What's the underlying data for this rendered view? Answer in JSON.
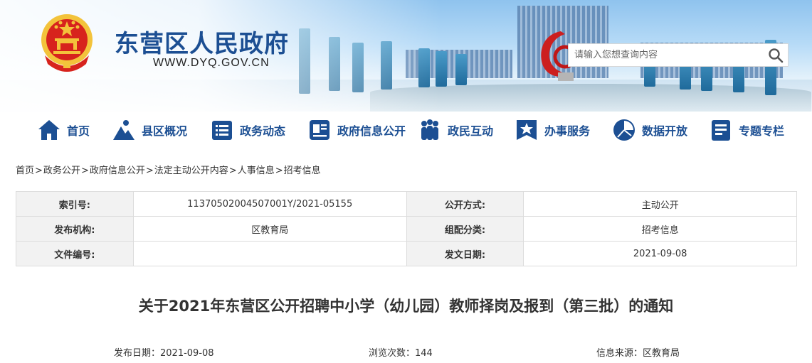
{
  "site": {
    "name": "东营区人民政府",
    "url": "WWW.DYQ.GOV.CN"
  },
  "search": {
    "placeholder": "请输入您想查询内容"
  },
  "nav": {
    "items": [
      {
        "label": "首页",
        "icon": "home-icon"
      },
      {
        "label": "县区概况",
        "icon": "mountain-icon"
      },
      {
        "label": "政务动态",
        "icon": "news-icon"
      },
      {
        "label": "政府信息公开",
        "icon": "document-icon"
      },
      {
        "label": "政民互动",
        "icon": "people-icon"
      },
      {
        "label": "办事服务",
        "icon": "star-icon"
      },
      {
        "label": "数据开放",
        "icon": "pie-chart-icon"
      },
      {
        "label": "专题专栏",
        "icon": "clipboard-icon"
      }
    ]
  },
  "breadcrumb": [
    "首页",
    "政务公开",
    "政府信息公开",
    "法定主动公开内容",
    "人事信息",
    "招考信息"
  ],
  "info": {
    "rows": [
      {
        "k1": "索引号:",
        "v1": "11370502004507001Y/2021-05155",
        "k2": "公开方式:",
        "v2": "主动公开"
      },
      {
        "k1": "发布机构:",
        "v1": "区教育局",
        "k2": "组配分类:",
        "v2": "招考信息"
      },
      {
        "k1": "文件编号:",
        "v1": "",
        "k2": "发文日期:",
        "v2": "2021-09-08"
      }
    ]
  },
  "article": {
    "title": "关于2021年东营区公开招聘中小学（幼儿园）教师择岗及报到（第三批）的通知",
    "publish_label": "发布日期：2021-09-08",
    "views_label": "浏览次数：",
    "views": "144",
    "source_label": "信息来源：区教育局"
  },
  "colors": {
    "brand_blue": "#1c4f93",
    "emblem_red": "#d7231d",
    "emblem_gold": "#f3c33b"
  }
}
